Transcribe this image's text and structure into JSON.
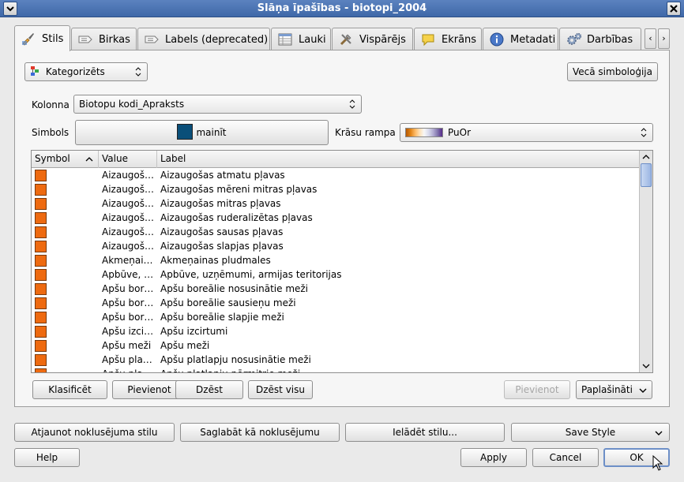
{
  "window": {
    "title": "Slāņa īpašības - biotopi_2004"
  },
  "tabs": [
    {
      "label": "Stils",
      "icon": "paintbrush-icon",
      "active": true
    },
    {
      "label": "Birkas",
      "icon": "label-tag-icon"
    },
    {
      "label": "Labels (deprecated)",
      "icon": "label-tag-icon"
    },
    {
      "label": "Lauki",
      "icon": "table-icon"
    },
    {
      "label": "Vispārējs",
      "icon": "tools-icon"
    },
    {
      "label": "Ekrāns",
      "icon": "speech-bubble-icon"
    },
    {
      "label": "Metadati",
      "icon": "info-icon"
    },
    {
      "label": "Darbības",
      "icon": "gears-icon"
    }
  ],
  "style": {
    "renderer_type": "Kategorizēts",
    "old_symbology_button": "Vecā simboloģija",
    "column_label": "Kolonna",
    "column_value": "Biotopu kodi_Apraksts",
    "symbol_label": "Simbols",
    "symbol_change_button": "mainīt",
    "symbol_color": "#0a4f79",
    "color_ramp_label": "Krāsu rampa",
    "color_ramp_value": "PuOr",
    "swatch_color": "#ee6a10"
  },
  "table": {
    "columns": [
      "Symbol",
      "Value",
      "Label"
    ],
    "rows": [
      {
        "value": "Aizaugoš…",
        "label": "Aizaugošas atmatu pļavas"
      },
      {
        "value": "Aizaugoš…",
        "label": "Aizaugošas mēreni mitras pļavas"
      },
      {
        "value": "Aizaugoš…",
        "label": "Aizaugošas mitras pļavas"
      },
      {
        "value": "Aizaugoš…",
        "label": "Aizaugošas ruderalizētas pļavas"
      },
      {
        "value": "Aizaugoš…",
        "label": "Aizaugošas sausas pļavas"
      },
      {
        "value": "Aizaugoš…",
        "label": "Aizaugošas slapjas pļavas"
      },
      {
        "value": "Akmeņai…",
        "label": "Akmeņainas pludmales"
      },
      {
        "value": "Apbūve, …",
        "label": "Apbūve, uzņēmumi, armijas teritorijas"
      },
      {
        "value": "Apšu bor…",
        "label": "Apšu boreālie nosusinātie meži"
      },
      {
        "value": "Apšu bor…",
        "label": "Apšu boreālie sausieņu meži"
      },
      {
        "value": "Apšu bor…",
        "label": "Apšu boreālie slapjie meži"
      },
      {
        "value": "Apšu izci…",
        "label": "Apšu izcirtumi"
      },
      {
        "value": "Apšu meži",
        "label": "Apšu meži"
      },
      {
        "value": "Apšu pla…",
        "label": "Apšu platlapju nosusinātie meži"
      },
      {
        "value": "Apšu pla…",
        "label": "Apšu platlapju pērmitrie meži"
      }
    ]
  },
  "panel_buttons": {
    "classify": "Klasificēt",
    "add": "Pievienot",
    "delete": "Dzēst",
    "delete_all": "Dzēst visu",
    "add_disabled": "Pievienot",
    "advanced": "Paplašināti"
  },
  "bottom": {
    "restore_default": "Atjaunot noklusējuma stilu",
    "save_default": "Saglabāt kā noklusējumu",
    "load_style": "Ielādēt stilu...",
    "save_style": "Save Style",
    "help": "Help",
    "apply": "Apply",
    "cancel": "Cancel",
    "ok": "OK"
  }
}
